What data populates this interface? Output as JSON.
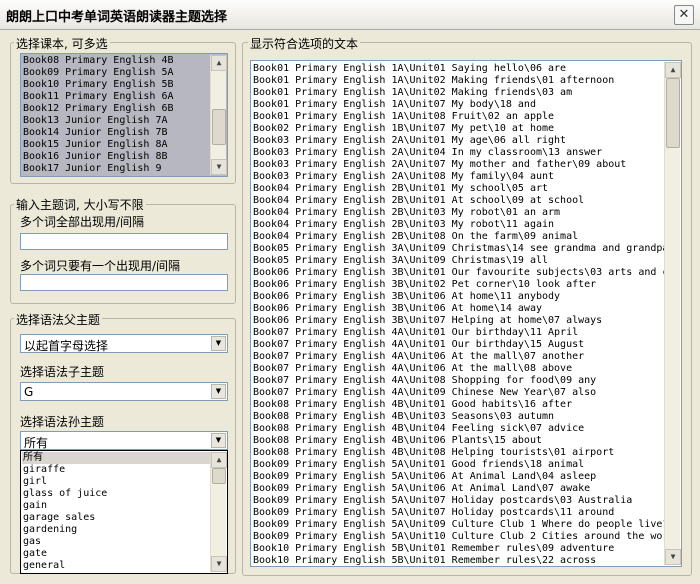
{
  "window": {
    "title": "朗朗上口中考单词英语朗读器主题选择",
    "close_glyph": "✕"
  },
  "books_group": {
    "label": "选择课本, 可多选",
    "items": [
      "Book08 Primary English 4B",
      "Book09 Primary English 5A",
      "Book10 Primary English 5B",
      "Book11 Primary English 6A",
      "Book12 Primary English 6B",
      "Book13 Junior English 7A",
      "Book14 Junior English 7B",
      "Book15 Junior English 8A",
      "Book16 Junior English 8B",
      "Book17 Junior English 9"
    ]
  },
  "keyword_group": {
    "label": "输入主题词, 大小写不限",
    "all_label": "多个词全部出现用/间隔",
    "all_value": "",
    "any_label": "多个词只要有一个出现用/间隔",
    "any_value": ""
  },
  "grammar_group": {
    "label": "选择语法父主题",
    "parent_value": "以起首字母选择",
    "child_label": "选择语法子主题",
    "child_value": "G",
    "grand_label": "选择语法孙主题",
    "grand_value": "所有",
    "grand_options": [
      "所有",
      "giraffe",
      "girl",
      "glass of juice",
      "gain",
      "garage sales",
      "gardening",
      "gas",
      "gate",
      "general"
    ]
  },
  "results_group": {
    "label": "显示符合选项的文本",
    "items": [
      "Book01 Primary English 1A\\Unit01 Saying hello\\06 are",
      "Book01 Primary English 1A\\Unit02 Making friends\\01 afternoon",
      "Book01 Primary English 1A\\Unit02 Making friends\\03 am",
      "Book01 Primary English 1A\\Unit07 My body\\18 and",
      "Book01 Primary English 1A\\Unit08 Fruit\\02 an apple",
      "Book02 Primary English 1B\\Unit07 My pet\\10 at home",
      "Book03 Primary English 2A\\Unit01 My age\\06 all right",
      "Book03 Primary English 2A\\Unit04 In my classroom\\13 answer",
      "Book03 Primary English 2A\\Unit07 My mother and father\\09 about",
      "Book03 Primary English 2A\\Unit08 My family\\04 aunt",
      "Book04 Primary English 2B\\Unit01 My school\\05 art",
      "Book04 Primary English 2B\\Unit01 At school\\09 at school",
      "Book04 Primary English 2B\\Unit03 My robot\\01 an arm",
      "Book04 Primary English 2B\\Unit03 My robot\\11 again",
      "Book04 Primary English 2B\\Unit08 On the farm\\09 animal",
      "Book05 Primary English 3A\\Unit09 Christmas\\14 see grandma and grandpa",
      "Book05 Primary English 3A\\Unit09 Christmas\\19 all",
      "Book06 Primary English 3B\\Unit01 Our favourite subjects\\03 arts and c",
      "Book06 Primary English 3B\\Unit02 Pet corner\\10 look after",
      "Book06 Primary English 3B\\Unit06 At home\\11 anybody",
      "Book06 Primary English 3B\\Unit06 At home\\14 away",
      "Book06 Primary English 3B\\Unit07 Helping at home\\07 always",
      "Book07 Primary English 4A\\Unit01 Our birthday\\11 April",
      "Book07 Primary English 4A\\Unit01 Our birthday\\15 August",
      "Book07 Primary English 4A\\Unit06 At the mall\\07 another",
      "Book07 Primary English 4A\\Unit06 At the mall\\08 above",
      "Book07 Primary English 4A\\Unit08 Shopping for food\\09 any",
      "Book07 Primary English 4A\\Unit09 Chinese New Year\\07 also",
      "Book08 Primary English 4B\\Unit01 Good habits\\16 after",
      "Book08 Primary English 4B\\Unit03 Seasons\\03 autumn",
      "Book08 Primary English 4B\\Unit04 Feeling sick\\07 advice",
      "Book08 Primary English 4B\\Unit06 Plants\\15 about",
      "Book08 Primary English 4B\\Unit08 Helping tourists\\01 airport",
      "Book09 Primary English 5A\\Unit01 Good friends\\18 animal",
      "Book09 Primary English 5A\\Unit06 At Animal Land\\04 asleep",
      "Book09 Primary English 5A\\Unit06 At Animal Land\\07 awake",
      "Book09 Primary English 5A\\Unit07 Holiday postcards\\03 Australia",
      "Book09 Primary English 5A\\Unit07 Holiday postcards\\11 around",
      "Book09 Primary English 5A\\Unit09 Culture Club 1 Where do people live?",
      "Book09 Primary English 5A\\Unit10 Culture Club 2 Cities around the wor",
      "Book10 Primary English 5B\\Unit01 Remember rules\\09 adventure",
      "Book10 Primary English 5B\\Unit01 Remember rules\\22 across"
    ]
  }
}
